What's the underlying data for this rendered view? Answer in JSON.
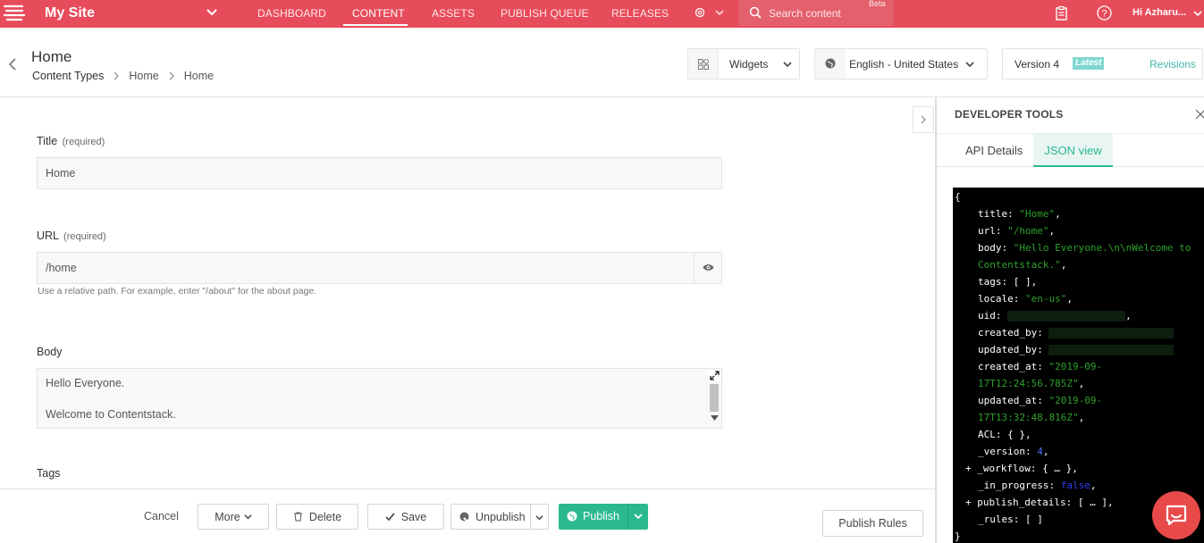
{
  "topbar": {
    "site_name": "My Site",
    "nav": [
      "DASHBOARD",
      "CONTENT",
      "ASSETS",
      "PUBLISH QUEUE",
      "RELEASES"
    ],
    "active_nav": "CONTENT",
    "search_placeholder": "Search content",
    "beta": "Beta",
    "user": "Hi Azharu...",
    "icons": [
      "logo-icon",
      "chevron-down-icon",
      "gear-icon",
      "search-icon",
      "clipboard-icon",
      "help-icon"
    ]
  },
  "header": {
    "title": "Home",
    "breadcrumb": [
      "Content Types",
      "Home",
      "Home"
    ],
    "widgets_label": "Widgets",
    "language": "English - United States",
    "version": "Version 4",
    "latest": "Latest",
    "revisions": "Revisions"
  },
  "form": {
    "title_label": "Title",
    "title_req": "(required)",
    "title_value": "Home",
    "url_label": "URL",
    "url_req": "(required)",
    "url_value": "/home",
    "url_help": "Use a relative path. For example, enter \"/about\" for the about page.",
    "body_label": "Body",
    "body_lines": [
      "Hello Everyone.",
      "Welcome to Contentstack."
    ],
    "tags_label": "Tags"
  },
  "footer": {
    "cancel": "Cancel",
    "more": "More",
    "delete": "Delete",
    "save": "Save",
    "unpublish": "Unpublish",
    "publish": "Publish",
    "publish_rules": "Publish Rules"
  },
  "devtools": {
    "title": "DEVELOPER TOOLS",
    "tabs": [
      "API Details",
      "JSON view"
    ],
    "active_tab": "JSON view",
    "json_lines": {
      "open": "{",
      "title_k": "title: ",
      "title_v": "\"Home\"",
      "url_k": "url: ",
      "url_v": "\"/home\"",
      "body_k": "body: ",
      "body_v1": "\"Hello Everyone.\\n\\nWelcome to",
      "body_v2": "Contentstack.\"",
      "tags": "tags: [ ],",
      "locale_k": "locale: ",
      "locale_v": "\"en-us\"",
      "uid_k": "uid: ",
      "created_by_k": "created_by: ",
      "updated_by_k": "updated_by: ",
      "created_at_k": "created_at: ",
      "created_at_v1": "\"2019-09-",
      "created_at_v2": "17T12:24:56.785Z\"",
      "updated_at_k": "updated_at: ",
      "updated_at_v1": "\"2019-09-",
      "updated_at_v2": "17T13:32:48.816Z\"",
      "acl": "ACL: { },",
      "version_k": "_version: ",
      "version_v": "4",
      "workflow": "_workflow: { … },",
      "in_progress_k": "_in_progress: ",
      "in_progress_v": "false",
      "publish_details": "publish_details: [ … ],",
      "rules": "_rules: [ ]",
      "close": "}"
    }
  }
}
